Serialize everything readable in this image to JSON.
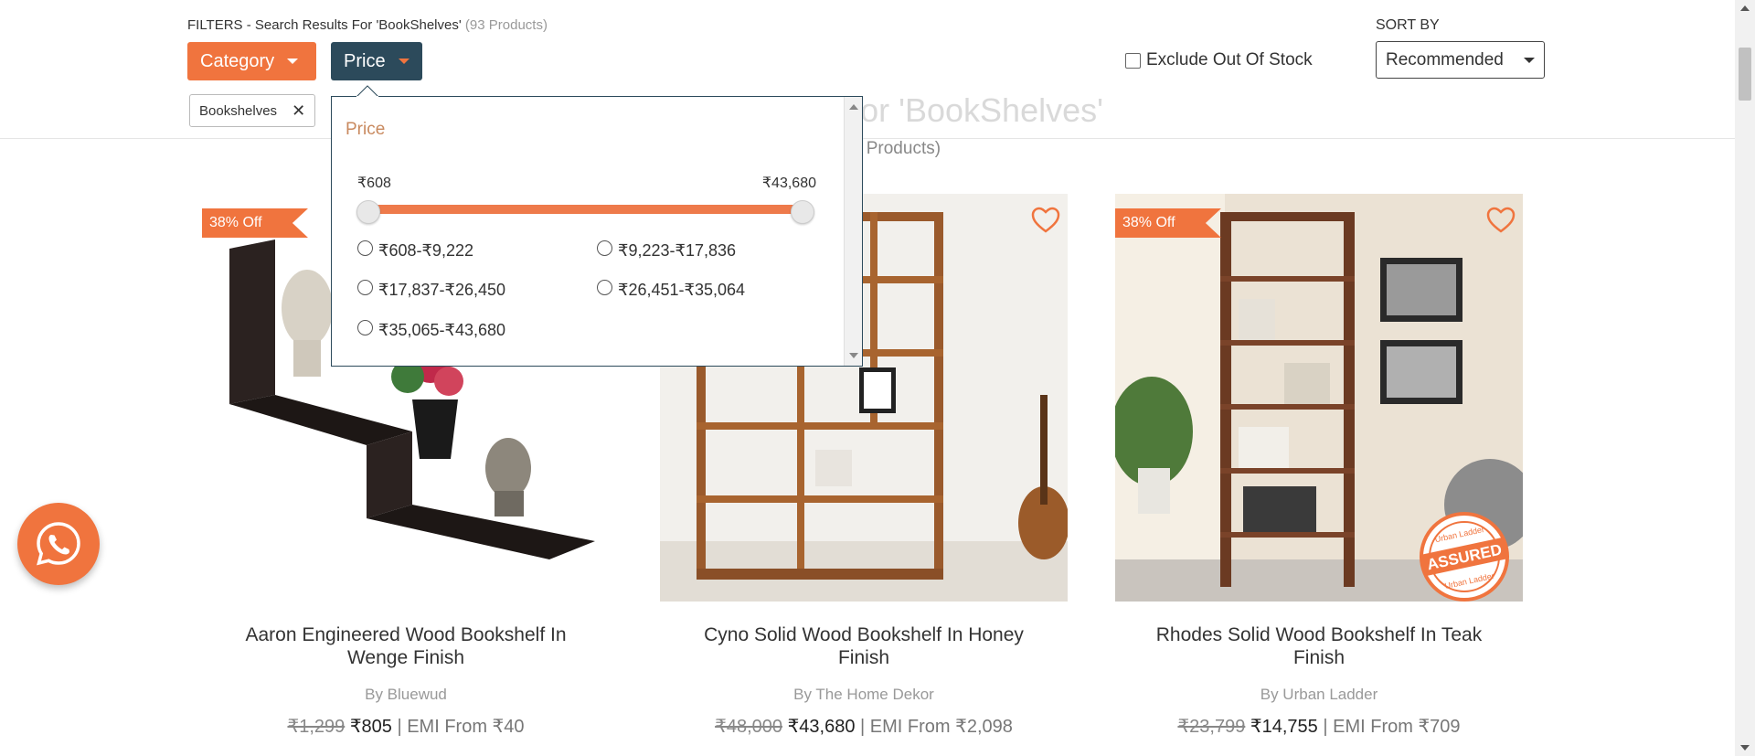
{
  "filters": {
    "heading_prefix": "FILTERS - Search Results For 'BookShelves'",
    "heading_count": "(93 Products)",
    "category_label": "Category",
    "price_label": "Price",
    "active_chip": "Bookshelves",
    "chip_remove": "✕",
    "exclude_label": "Exclude Out Of Stock",
    "sort_label": "SORT BY",
    "sort_value": "Recommended"
  },
  "background": {
    "title": "Search Results For 'BookShelves'",
    "subtitle": "(93 Products)"
  },
  "price_popover": {
    "title": "Price",
    "min": "₹608",
    "max": "₹43,680",
    "options": [
      "₹608-₹9,222",
      "₹9,223-₹17,836",
      "₹17,837-₹26,450",
      "₹26,451-₹35,064",
      "₹35,065-₹43,680"
    ]
  },
  "products": [
    {
      "discount": "38% Off",
      "name": "Aaron Engineered Wood Bookshelf In Wenge Finish",
      "by": "By Bluewud",
      "mrp": "₹1,299",
      "price": "₹805",
      "emi": "| EMI From ₹40"
    },
    {
      "discount": "",
      "name": "Cyno Solid Wood Bookshelf In Honey Finish",
      "by": "By The Home Dekor",
      "mrp": "₹48,000",
      "price": "₹43,680",
      "emi": "| EMI From ₹2,098"
    },
    {
      "discount": "38% Off",
      "name": "Rhodes Solid Wood Bookshelf In Teak Finish",
      "by": "By Urban Ladder",
      "mrp": "₹23,799",
      "price": "₹14,755",
      "emi": "| EMI From ₹709"
    }
  ],
  "assured_stamp": {
    "top": "Urban Ladder",
    "main": "ASSURED",
    "bottom": "Urban Ladder"
  },
  "colors": {
    "accent": "#f0743e",
    "price_button": "#2c4a5b"
  }
}
